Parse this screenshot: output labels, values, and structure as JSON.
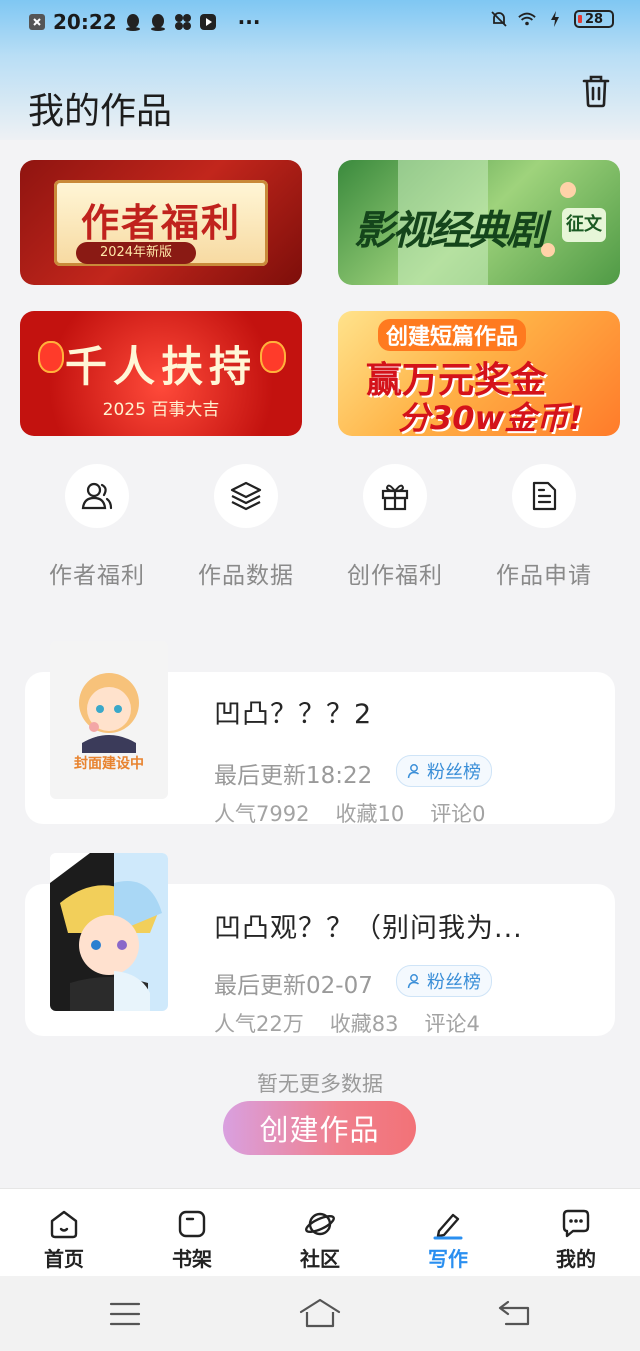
{
  "status_bar": {
    "time": "20:22",
    "more": "···",
    "battery": "28"
  },
  "header": {
    "title": "我的作品"
  },
  "banners": [
    {
      "title": "作者福利",
      "subtitle": "2024年新版"
    },
    {
      "title": "影视经典剧",
      "tag": "征文"
    },
    {
      "title": "千人扶持",
      "subtitle": "2025 百事大吉"
    },
    {
      "line1": "创建短篇作品",
      "line2": "赢万元奖金",
      "line3": "分30w金币!"
    }
  ],
  "quick_actions": [
    {
      "label": "作者福利",
      "icon": "users-icon"
    },
    {
      "label": "作品数据",
      "icon": "layers-icon"
    },
    {
      "label": "创作福利",
      "icon": "gift-icon"
    },
    {
      "label": "作品申请",
      "icon": "document-icon"
    }
  ],
  "works": [
    {
      "cover_text": "封面建设中",
      "title": "凹凸？？？2",
      "updated": "最后更新18:22",
      "badge": "粉丝榜",
      "popularity": "人气7992",
      "favorites": "收藏10",
      "comments": "评论0"
    },
    {
      "title": "凹凸观？？（别问我为...",
      "updated": "最后更新02-07",
      "badge": "粉丝榜",
      "popularity": "人气22万",
      "favorites": "收藏83",
      "comments": "评论4"
    }
  ],
  "footer": {
    "no_more": "暂无更多数据",
    "create_button": "创建作品"
  },
  "tabs": [
    {
      "label": "首页",
      "icon": "home-icon"
    },
    {
      "label": "书架",
      "icon": "bookshelf-icon"
    },
    {
      "label": "社区",
      "icon": "planet-icon"
    },
    {
      "label": "写作",
      "icon": "pen-icon",
      "active": true
    },
    {
      "label": "我的",
      "icon": "chat-icon"
    }
  ],
  "colors": {
    "accent": "#2a8ff0",
    "badge_text": "#3b8fd8",
    "create_gradient_start": "#d9a0e0",
    "create_gradient_end": "#f27277"
  }
}
